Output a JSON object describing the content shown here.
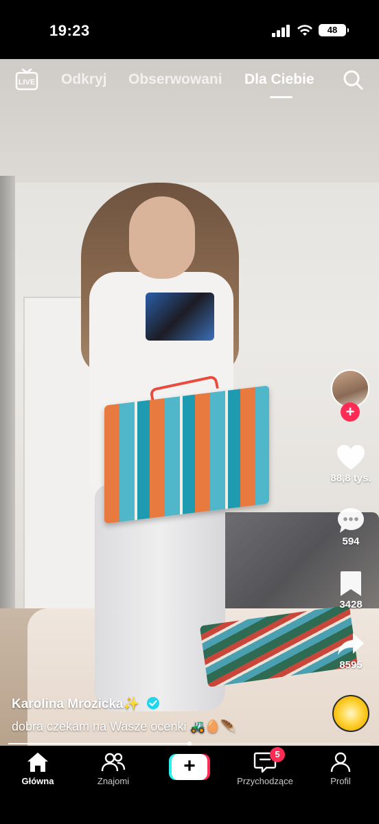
{
  "status_bar": {
    "time": "19:23",
    "battery": "48"
  },
  "top_nav": {
    "live_icon": "live-icon",
    "tabs": [
      {
        "label": "Odkryj",
        "active": false
      },
      {
        "label": "Obserwowani",
        "active": false
      },
      {
        "label": "Dla Ciebie",
        "active": true
      }
    ],
    "search_icon": "search-icon"
  },
  "rail": {
    "likes": "88,8 tys.",
    "comments": "594",
    "saves": "3428",
    "shares": "8595"
  },
  "post": {
    "author": "Karolina Mrozicka",
    "author_emoji": "✨",
    "verified": true,
    "caption": "dobra czekam na Wasze ocenki 🚜🥚🪶",
    "progress": 0.5
  },
  "bottom_nav": {
    "items": [
      {
        "label": "Główna",
        "icon": "home-icon",
        "active": true
      },
      {
        "label": "Znajomi",
        "icon": "friends-icon",
        "active": false
      },
      {
        "label": "",
        "icon": "create-icon",
        "active": false
      },
      {
        "label": "Przychodzące",
        "icon": "inbox-icon",
        "active": false,
        "badge": "5"
      },
      {
        "label": "Profil",
        "icon": "profile-icon",
        "active": false
      }
    ]
  },
  "colors": {
    "accent": "#fe2c55",
    "cyan": "#25f4ee",
    "background": "#000000"
  }
}
